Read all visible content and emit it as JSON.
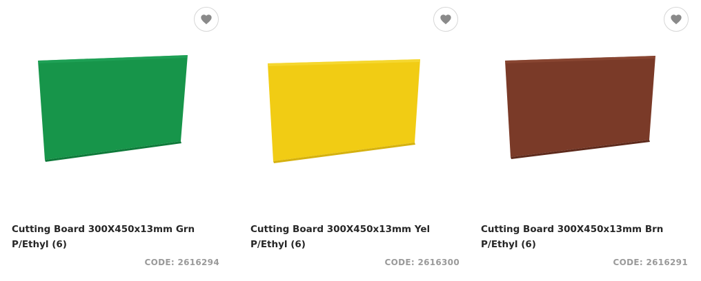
{
  "products": [
    {
      "title_line1": "Cutting Board 300X450x13mm Grn",
      "title_line2": "P/Ethyl (6)",
      "code_label": "CODE:",
      "code_value": "2616294",
      "board_color": "#17954a",
      "icon": "heart-icon"
    },
    {
      "title_line1": "Cutting Board 300X450x13mm Yel",
      "title_line2": "P/Ethyl (6)",
      "code_label": "CODE:",
      "code_value": "2616300",
      "board_color": "#f1cc14",
      "icon": "heart-icon"
    },
    {
      "title_line1": "Cutting Board 300X450x13mm Brn",
      "title_line2": "P/Ethyl (6)",
      "code_label": "CODE:",
      "code_value": "2616291",
      "board_color": "#7a3a28",
      "icon": "heart-icon"
    }
  ]
}
